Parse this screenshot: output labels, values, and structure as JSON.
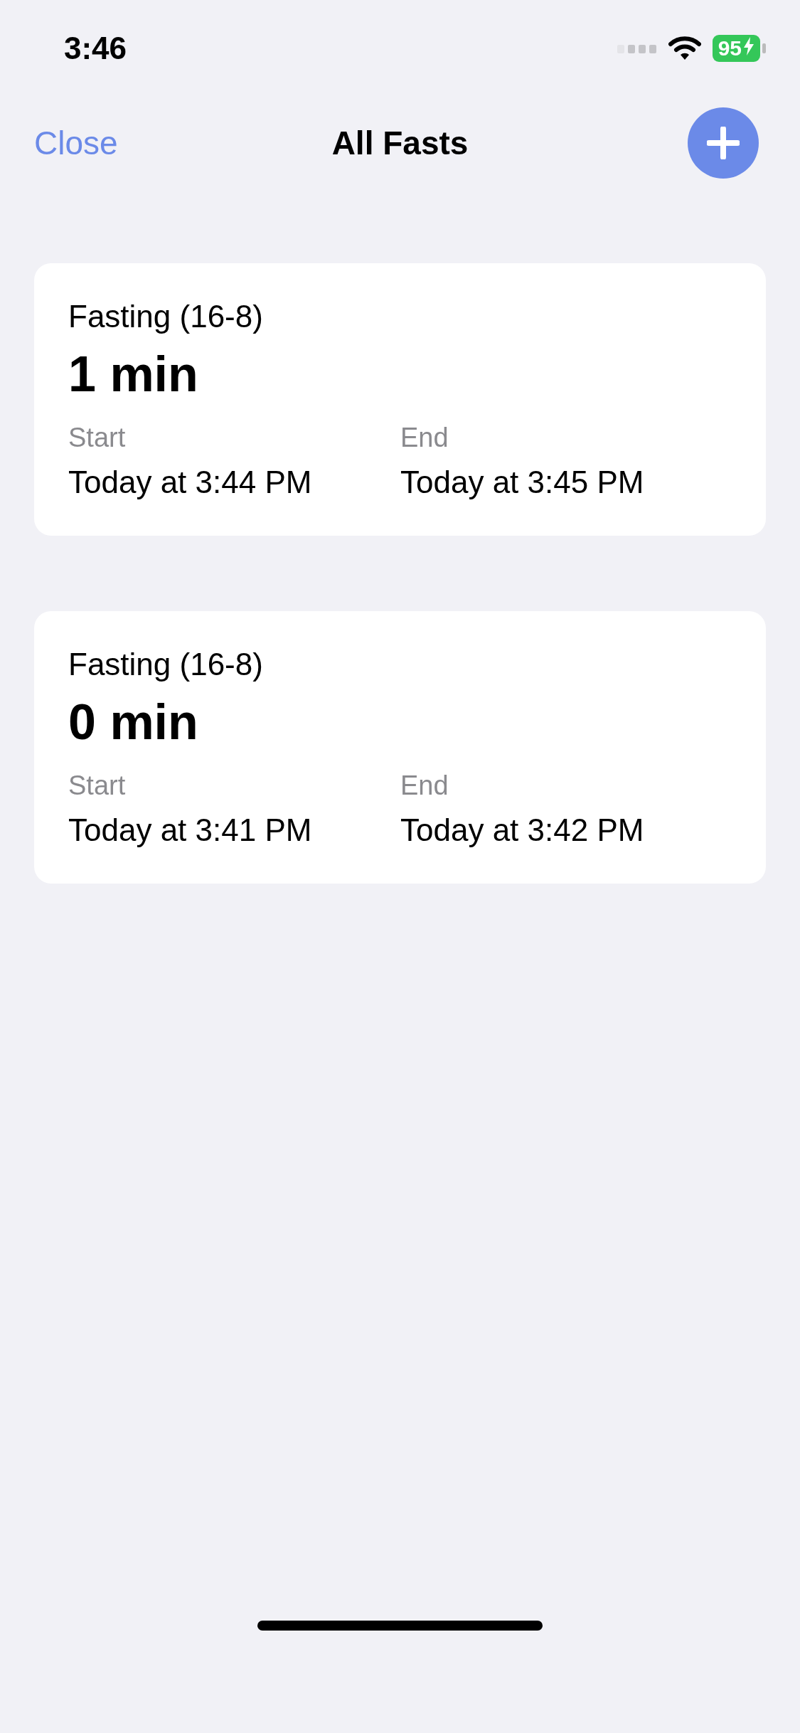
{
  "status_bar": {
    "time": "3:46",
    "battery": "95"
  },
  "nav": {
    "close": "Close",
    "title": "All Fasts"
  },
  "fasts": [
    {
      "plan": "Fasting (16-8)",
      "duration": "1 min",
      "start_label": "Start",
      "start": "Today at 3:44 PM",
      "end_label": "End",
      "end": "Today at 3:45 PM"
    },
    {
      "plan": "Fasting (16-8)",
      "duration": "0 min",
      "start_label": "Start",
      "start": "Today at 3:41 PM",
      "end_label": "End",
      "end": "Today at 3:42 PM"
    }
  ]
}
